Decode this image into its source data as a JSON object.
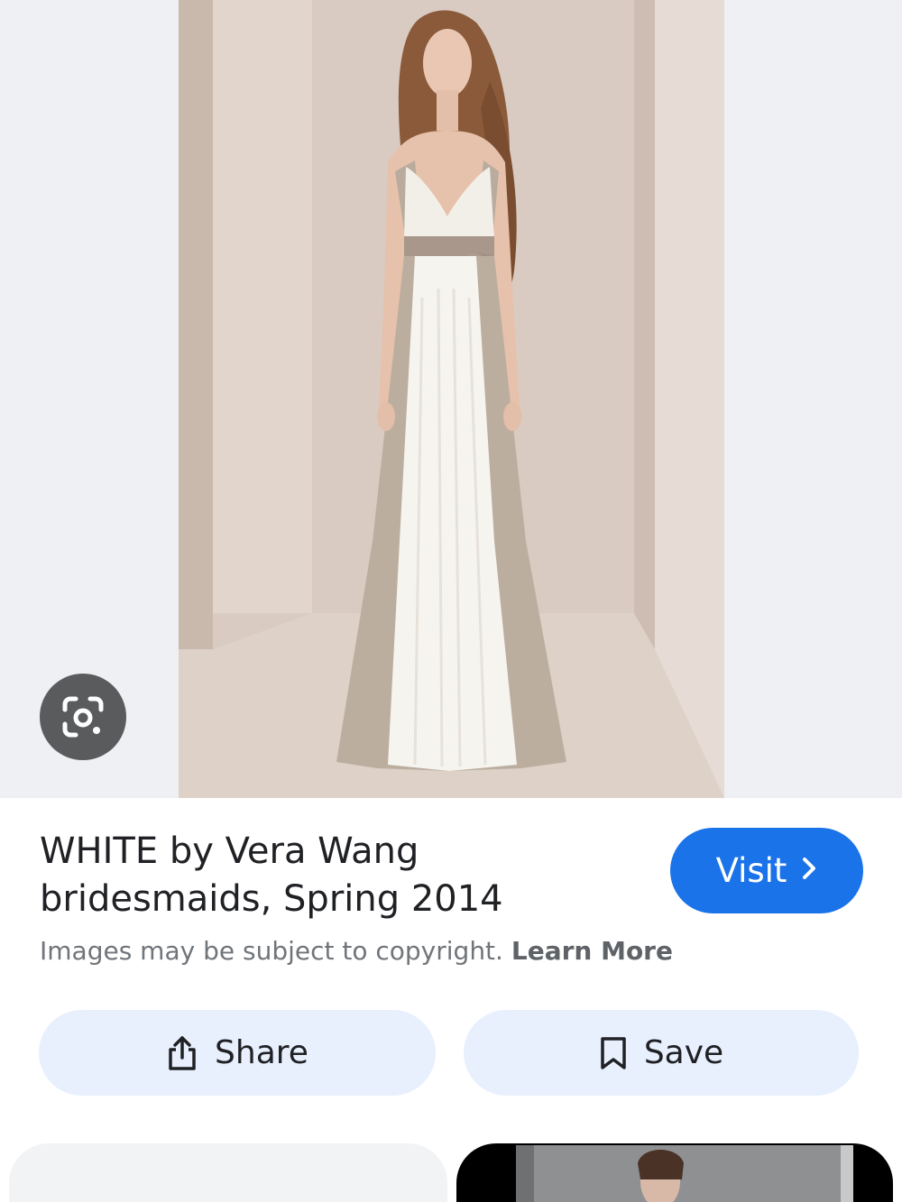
{
  "result": {
    "title": "WHITE by Vera Wang bridesmaids, Spring 2014",
    "visit_label": "Visit",
    "copyright_text": "Images may be subject to copyright.",
    "learn_more_label": "Learn More"
  },
  "actions": {
    "share_label": "Share",
    "save_label": "Save"
  },
  "icons": {
    "lens": "google-lens-icon",
    "chevron": "chevron-right-icon",
    "share": "share-icon",
    "save": "bookmark-icon"
  },
  "colors": {
    "accent": "#1a73e8",
    "action_bg": "#e8f0fe",
    "image_bg": "#eef0f3"
  }
}
